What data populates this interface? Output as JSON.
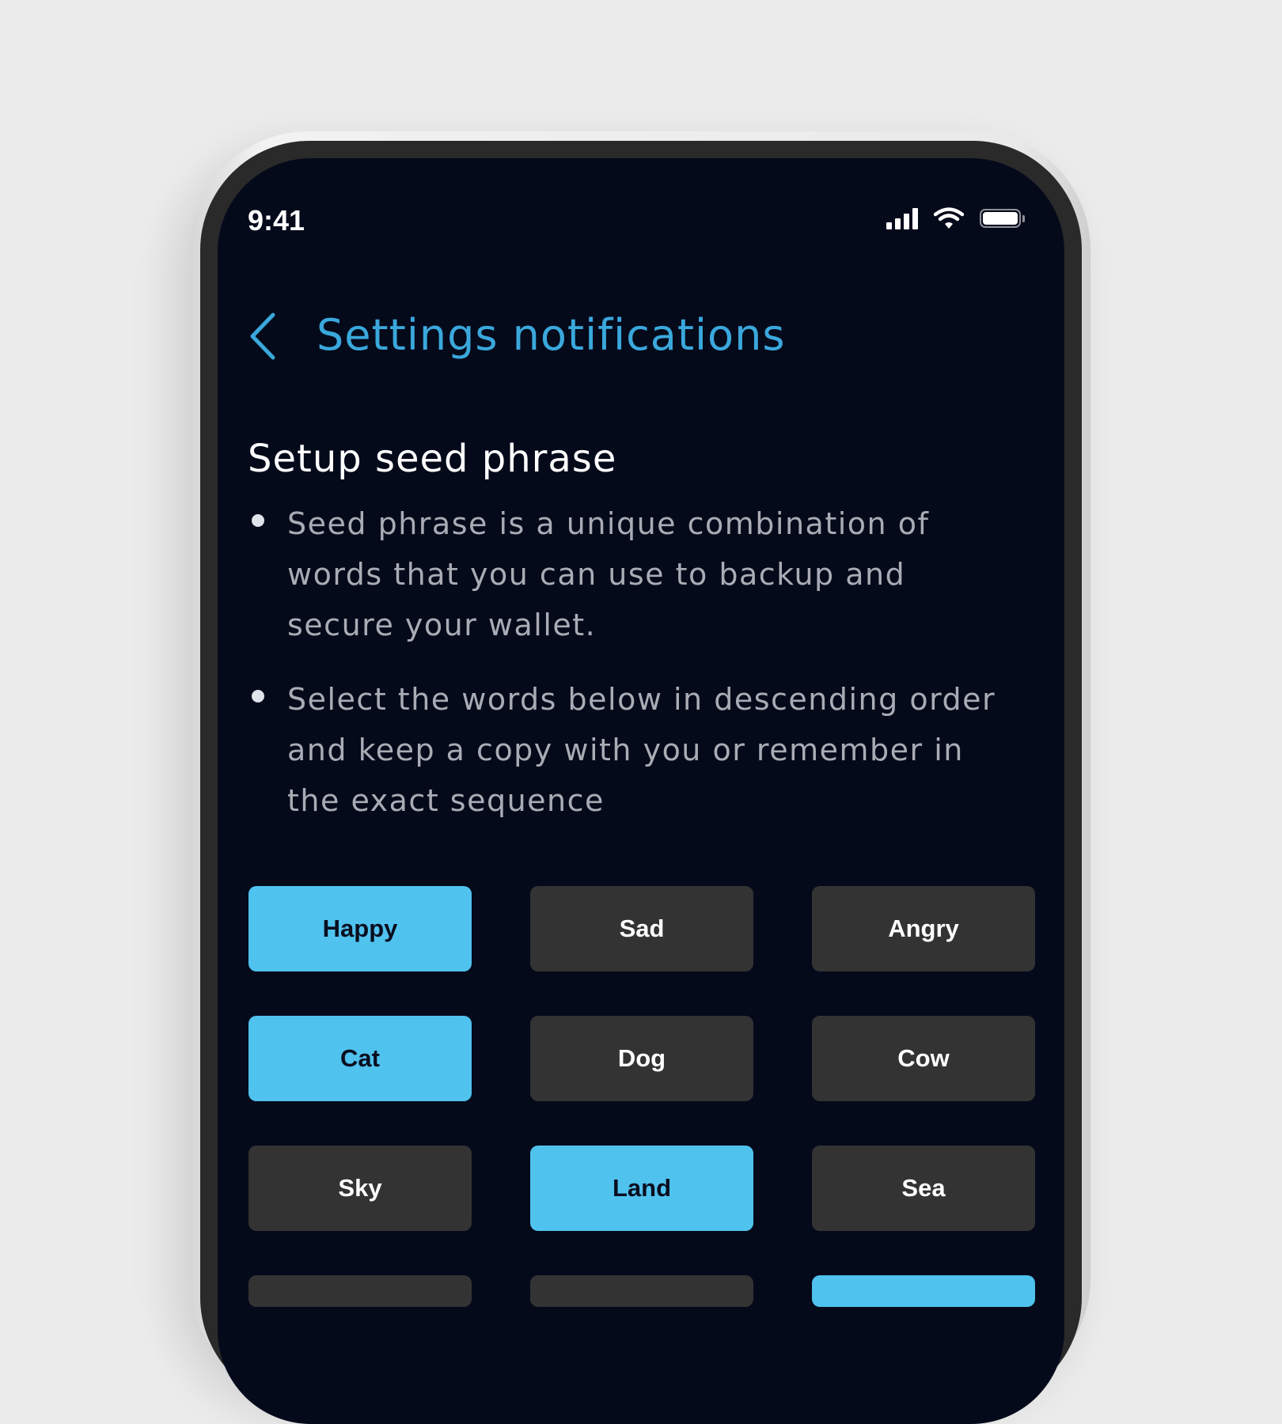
{
  "status_bar": {
    "time": "9:41"
  },
  "header": {
    "title": "Settings notifications",
    "back_icon": "chevron-left-icon"
  },
  "section": {
    "heading": "Setup seed phrase",
    "bullets": [
      "Seed phrase is a unique combination of words that you can use to backup and secure your wallet.",
      "Select the words below in descending order and keep a copy with you or remember in the exact sequence"
    ]
  },
  "words": [
    {
      "label": "Happy",
      "selected": true
    },
    {
      "label": "Sad",
      "selected": false
    },
    {
      "label": "Angry",
      "selected": false
    },
    {
      "label": "Cat",
      "selected": true
    },
    {
      "label": "Dog",
      "selected": false
    },
    {
      "label": "Cow",
      "selected": false
    },
    {
      "label": "Sky",
      "selected": false
    },
    {
      "label": "Land",
      "selected": true
    },
    {
      "label": "Sea",
      "selected": false
    }
  ],
  "colors": {
    "accent": "#3aa8dc",
    "chip_selected": "#4fc2ee",
    "chip_default": "#333333",
    "background": "#050a1b"
  }
}
